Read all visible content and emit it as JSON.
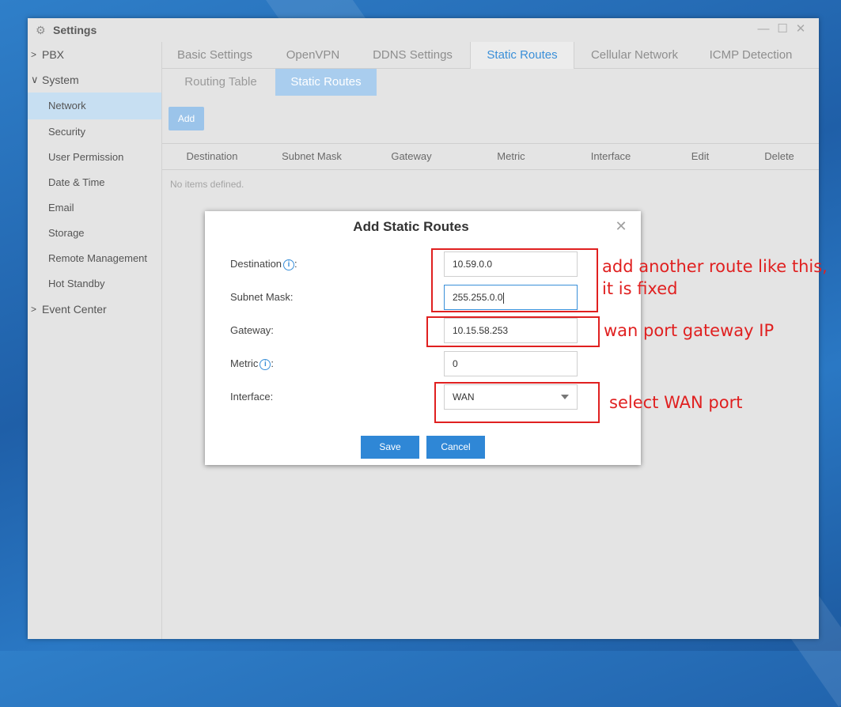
{
  "window": {
    "title": "Settings"
  },
  "sidebar": {
    "items": [
      {
        "label": "PBX",
        "expanded": false
      },
      {
        "label": "System",
        "expanded": true
      },
      {
        "label": "Network",
        "active": true
      },
      {
        "label": "Security"
      },
      {
        "label": "User Permission"
      },
      {
        "label": "Date & Time"
      },
      {
        "label": "Email"
      },
      {
        "label": "Storage"
      },
      {
        "label": "Remote Management"
      },
      {
        "label": "Hot Standby"
      },
      {
        "label": "Event Center",
        "expanded": false
      }
    ]
  },
  "tabs": [
    {
      "label": "Basic Settings"
    },
    {
      "label": "OpenVPN"
    },
    {
      "label": "DDNS Settings"
    },
    {
      "label": "Static Routes",
      "active": true
    },
    {
      "label": "Cellular Network"
    },
    {
      "label": "ICMP Detection"
    }
  ],
  "subtabs": [
    {
      "label": "Routing Table"
    },
    {
      "label": "Static Routes",
      "active": true
    }
  ],
  "toolbar": {
    "add_label": "Add"
  },
  "table": {
    "columns": [
      "Destination",
      "Subnet Mask",
      "Gateway",
      "Metric",
      "Interface",
      "Edit",
      "Delete"
    ],
    "empty_text": "No items defined."
  },
  "dialog": {
    "title": "Add Static Routes",
    "fields": {
      "destination": {
        "label": "Destination",
        "value": "10.59.0.0"
      },
      "subnet_mask": {
        "label": "Subnet Mask:",
        "value": "255.255.0.0"
      },
      "gateway": {
        "label": "Gateway:",
        "value": "10.15.58.253"
      },
      "metric": {
        "label": "Metric",
        "value": "0"
      },
      "interface": {
        "label": "Interface:",
        "value": "WAN"
      }
    },
    "save_label": "Save",
    "cancel_label": "Cancel"
  },
  "annotations": {
    "note1_line1": "add another route like this,",
    "note1_line2": "it is fixed",
    "note2": "wan port gateway IP",
    "note3": "select WAN port",
    "color": "#e02020"
  },
  "colors": {
    "accent": "#3a8fd8",
    "button": "#2f87d6",
    "active_nav": "#c7dff2"
  }
}
